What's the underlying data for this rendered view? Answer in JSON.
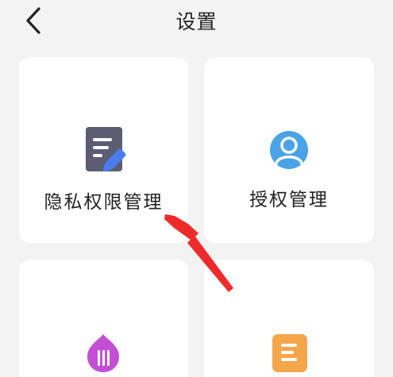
{
  "header": {
    "title": "设置",
    "back_icon": "back-arrow-icon"
  },
  "cards": [
    {
      "label": "隐私权限管理",
      "icon": "document-edit-icon",
      "color": "#5b5e72",
      "accent": "#4a7cf0"
    },
    {
      "label": "授权管理",
      "icon": "user-avatar-icon",
      "color": "#4aa3e6"
    },
    {
      "label": "",
      "icon": "purple-drop-icon",
      "color": "#c24fd4"
    },
    {
      "label": "",
      "icon": "orange-document-icon",
      "color": "#f5a64a"
    }
  ],
  "annotation": {
    "color": "#ee2a2a"
  }
}
